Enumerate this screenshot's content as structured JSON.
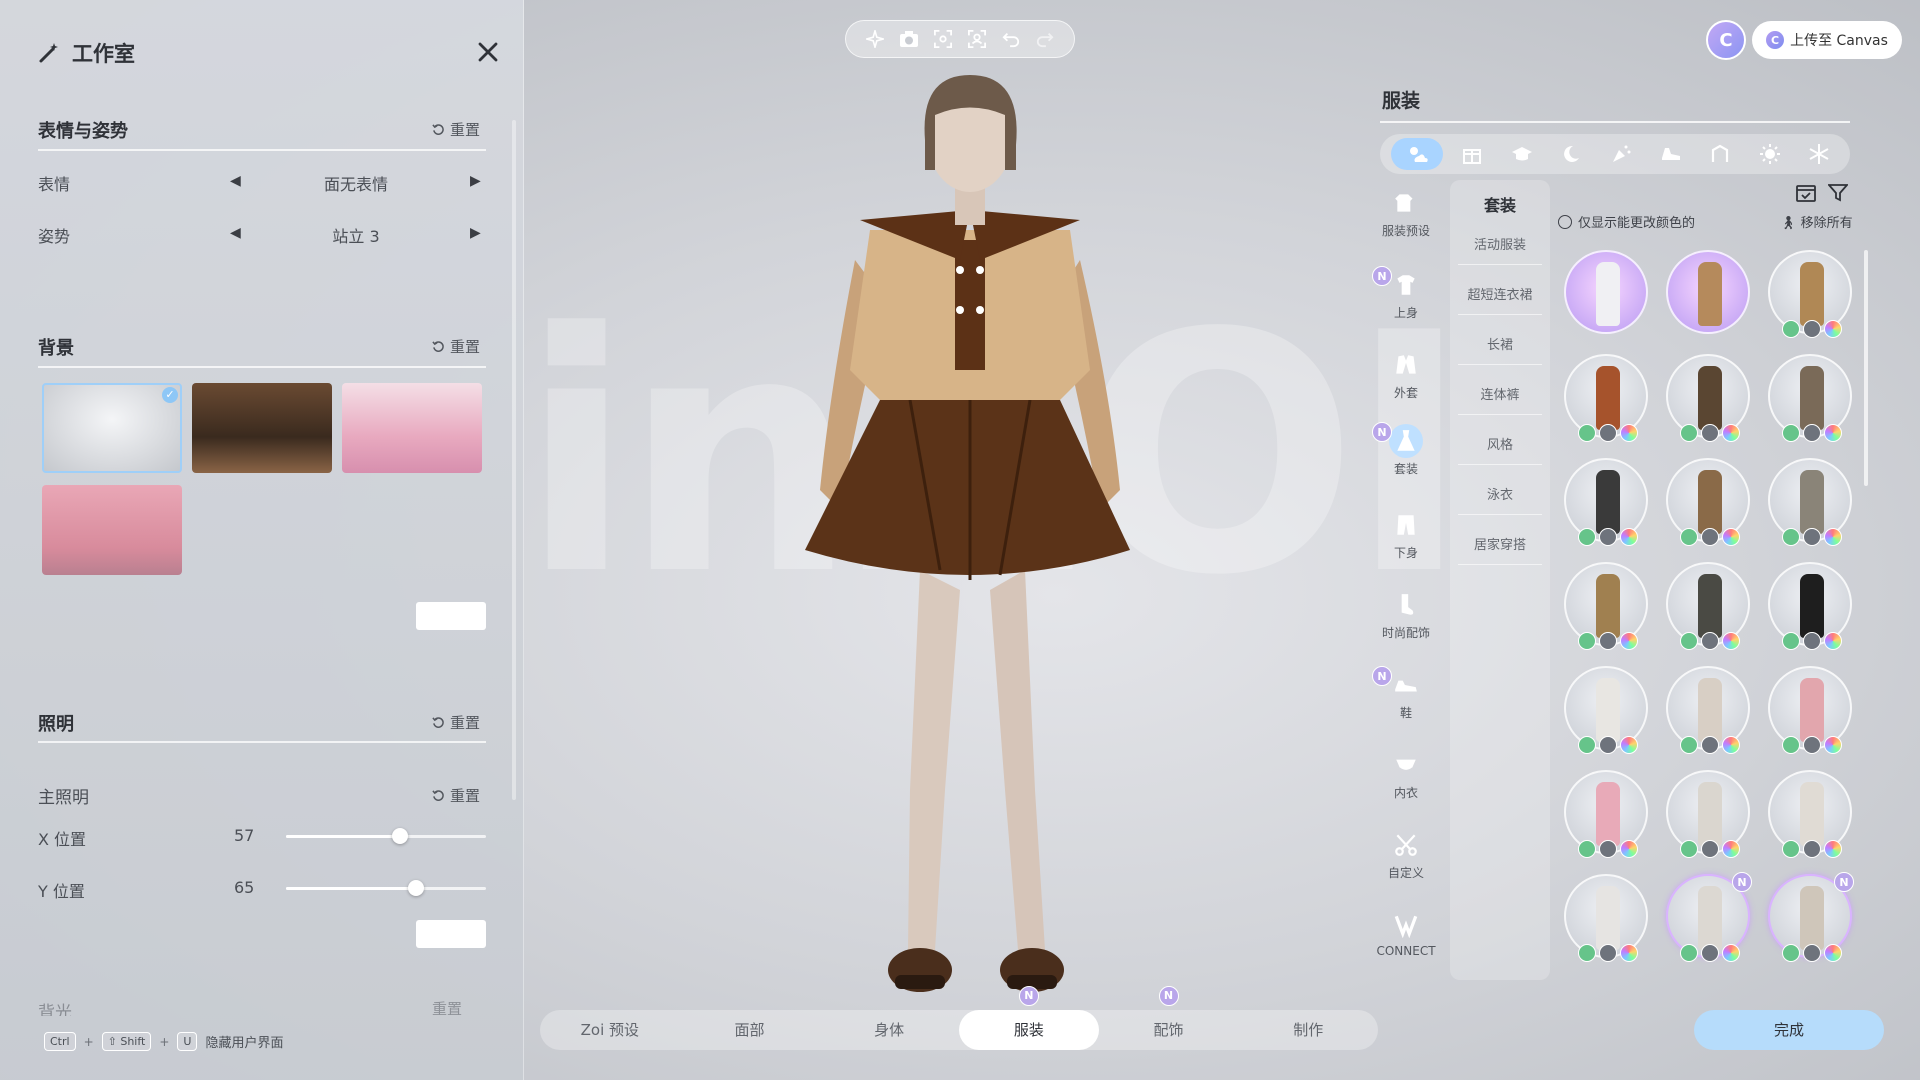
{
  "studio": {
    "title": "工作室",
    "reset_label": "重置",
    "expression_section": {
      "title": "表情与姿势",
      "rows": [
        {
          "label": "表情",
          "value": "面无表情"
        },
        {
          "label": "姿势",
          "value": "站立 3"
        }
      ]
    },
    "background_section": {
      "title": "背景",
      "selected_index": 0
    },
    "lighting_section": {
      "title": "照明",
      "main_light": "主照明",
      "x_label": "X 位置",
      "x_value": "57",
      "x_level": 0.57,
      "y_label": "Y 位置",
      "y_value": "65",
      "y_level": 0.65,
      "back_light": "背光"
    },
    "shortcut": {
      "key1": "Ctrl",
      "key2": "⇧ Shift",
      "key3": "U",
      "label": "隐藏用户界面"
    }
  },
  "watermark": "inZOI",
  "toolbar_icons": [
    "sparkle-icon",
    "camera-icon",
    "focus-icon",
    "face-focus-icon",
    "undo-icon",
    "redo-icon"
  ],
  "bottom_tabs": [
    {
      "label": "Zoi 预设",
      "active": false,
      "new": false
    },
    {
      "label": "面部",
      "active": false,
      "new": false
    },
    {
      "label": "身体",
      "active": false,
      "new": false
    },
    {
      "label": "服装",
      "active": true,
      "new": true
    },
    {
      "label": "配饰",
      "active": false,
      "new": true
    },
    {
      "label": "制作",
      "active": false,
      "new": false
    }
  ],
  "new_badge": "N",
  "canvas": {
    "avatar_letter": "C",
    "upload_label": "上传至 Canvas"
  },
  "clothing": {
    "title": "服装",
    "category_icons": [
      "weather-all-icon",
      "gift-icon",
      "graduation-icon",
      "night-icon",
      "party-icon",
      "shoe-icon",
      "sports-icon",
      "sun-icon",
      "snowflake-icon"
    ],
    "side_nav": [
      {
        "label": "服装预设",
        "icon": "outfit-preset-icon",
        "new": false
      },
      {
        "label": "上身",
        "icon": "tshirt-icon",
        "new": true
      },
      {
        "label": "外套",
        "icon": "jacket-icon",
        "new": false
      },
      {
        "label": "套装",
        "icon": "dress-icon",
        "new": true,
        "active": true
      },
      {
        "label": "下身",
        "icon": "pants-icon",
        "new": false
      },
      {
        "label": "时尚配饰",
        "icon": "sock-icon",
        "new": false
      },
      {
        "label": "鞋",
        "icon": "sneaker-icon",
        "new": true
      },
      {
        "label": "内衣",
        "icon": "underwear-icon",
        "new": false
      },
      {
        "label": "自定义",
        "icon": "scissors-icon",
        "new": false
      },
      {
        "label": "CONNECT",
        "icon": "connect-icon",
        "new": false
      }
    ],
    "sub_category": {
      "title": "套装",
      "items": [
        "活动服装",
        "超短连衣裙",
        "长裙",
        "连体裤",
        "风格",
        "泳衣",
        "居家穿搭"
      ]
    },
    "filter_label": "仅显示能更改颜色的",
    "remove_all": "移除所有",
    "done": "完成",
    "outfits": [
      {
        "color": "#f0f0f3",
        "style": "purple",
        "badges": false,
        "new": false
      },
      {
        "color": "#b58a5c",
        "style": "purple",
        "badges": false,
        "new": false
      },
      {
        "color": "#b08855",
        "style": "normal",
        "badges": true,
        "new": false
      },
      {
        "color": "#a6532c",
        "style": "normal",
        "badges": true,
        "new": false
      },
      {
        "color": "#5a4632",
        "style": "normal",
        "badges": true,
        "new": false
      },
      {
        "color": "#7a6a58",
        "style": "normal",
        "badges": true,
        "new": false
      },
      {
        "color": "#3a3a3a",
        "style": "normal",
        "badges": true,
        "new": false
      },
      {
        "color": "#8a6a48",
        "style": "normal",
        "badges": true,
        "new": false
      },
      {
        "color": "#8a8478",
        "style": "normal",
        "badges": true,
        "new": false
      },
      {
        "color": "#a08050",
        "style": "normal",
        "badges": true,
        "new": false
      },
      {
        "color": "#4a4a44",
        "style": "normal",
        "badges": true,
        "new": false
      },
      {
        "color": "#1e1e1e",
        "style": "normal",
        "badges": true,
        "new": false
      },
      {
        "color": "#e8e6e2",
        "style": "normal",
        "badges": true,
        "new": false
      },
      {
        "color": "#d8cfc5",
        "style": "normal",
        "badges": true,
        "new": false
      },
      {
        "color": "#e2a6ad",
        "style": "normal",
        "badges": true,
        "new": false
      },
      {
        "color": "#e8aab8",
        "style": "normal",
        "badges": true,
        "new": false
      },
      {
        "color": "#dad6cf",
        "style": "normal",
        "badges": true,
        "new": false
      },
      {
        "color": "#e0dbd4",
        "style": "normal",
        "badges": true,
        "new": false
      },
      {
        "color": "#e6e4e2",
        "style": "normal",
        "badges": true,
        "new": false
      },
      {
        "color": "#dcd8d2",
        "style": "ring",
        "badges": true,
        "new": true
      },
      {
        "color": "#cfc6ba",
        "style": "ring",
        "badges": true,
        "new": true
      }
    ]
  }
}
